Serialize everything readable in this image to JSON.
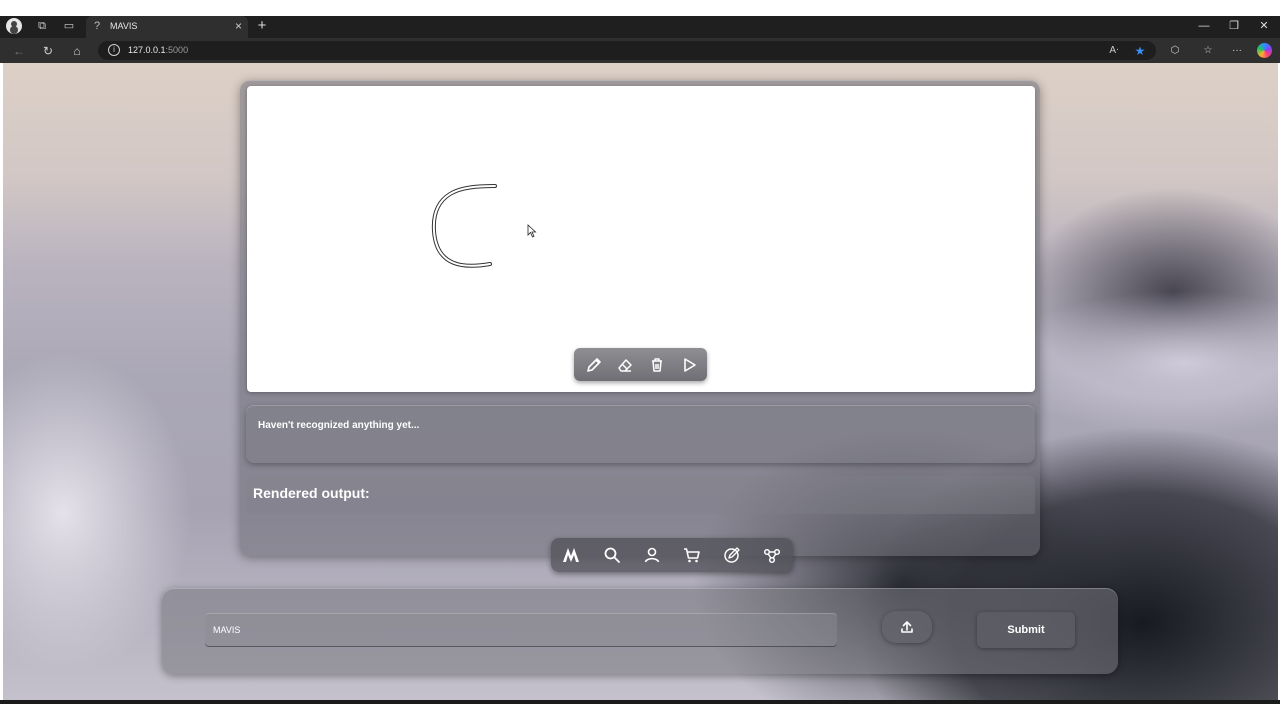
{
  "browser": {
    "tab_title": "MAVIS",
    "tab_favicon": "?",
    "url_host": "127.0.0.1",
    "url_port": ":5000"
  },
  "app": {
    "recognition_text": "Haven't recognized anything yet...",
    "rendered_title": "Rendered output:",
    "prompt_value": "MAVIS",
    "submit_label": "Submit"
  },
  "colors": {
    "star_accent": "#3b8ff5",
    "panel_glass": "rgba(110,110,118,0.55)"
  },
  "icons": {
    "draw_toolbar": [
      "pencil-icon",
      "eraser-icon",
      "trash-icon",
      "play-icon"
    ],
    "bottom_nav": [
      "logo-icon",
      "search-icon",
      "user-icon",
      "cart-icon",
      "edit-icon",
      "share-icon"
    ]
  }
}
